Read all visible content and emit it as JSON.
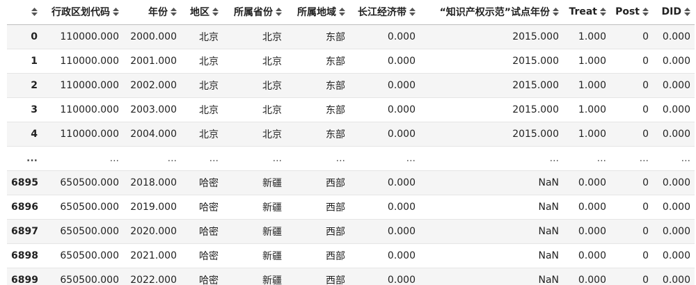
{
  "table": {
    "columns": [
      "",
      "行政区划代码",
      "年份",
      "地区",
      "所属省份",
      "所属地域",
      "长江经济带",
      "“知识产权示范”试点年份",
      "Treat",
      "Post",
      "DID"
    ],
    "rows": [
      [
        "0",
        "110000.000",
        "2000.000",
        "北京",
        "北京",
        "东部",
        "0.000",
        "2015.000",
        "1.000",
        "0",
        "0.000"
      ],
      [
        "1",
        "110000.000",
        "2001.000",
        "北京",
        "北京",
        "东部",
        "0.000",
        "2015.000",
        "1.000",
        "0",
        "0.000"
      ],
      [
        "2",
        "110000.000",
        "2002.000",
        "北京",
        "北京",
        "东部",
        "0.000",
        "2015.000",
        "1.000",
        "0",
        "0.000"
      ],
      [
        "3",
        "110000.000",
        "2003.000",
        "北京",
        "北京",
        "东部",
        "0.000",
        "2015.000",
        "1.000",
        "0",
        "0.000"
      ],
      [
        "4",
        "110000.000",
        "2004.000",
        "北京",
        "北京",
        "东部",
        "0.000",
        "2015.000",
        "1.000",
        "0",
        "0.000"
      ],
      [
        "...",
        "...",
        "...",
        "...",
        "...",
        "...",
        "...",
        "...",
        "...",
        "...",
        "..."
      ],
      [
        "6895",
        "650500.000",
        "2018.000",
        "哈密",
        "新疆",
        "西部",
        "0.000",
        "NaN",
        "0.000",
        "0",
        "0.000"
      ],
      [
        "6896",
        "650500.000",
        "2019.000",
        "哈密",
        "新疆",
        "西部",
        "0.000",
        "NaN",
        "0.000",
        "0",
        "0.000"
      ],
      [
        "6897",
        "650500.000",
        "2020.000",
        "哈密",
        "新疆",
        "西部",
        "0.000",
        "NaN",
        "0.000",
        "0",
        "0.000"
      ],
      [
        "6898",
        "650500.000",
        "2021.000",
        "哈密",
        "新疆",
        "西部",
        "0.000",
        "NaN",
        "0.000",
        "0",
        "0.000"
      ],
      [
        "6899",
        "650500.000",
        "2022.000",
        "哈密",
        "新疆",
        "西部",
        "0.000",
        "NaN",
        "0.000",
        "0",
        "0.000"
      ]
    ]
  },
  "icons": {
    "sort": "sort-icon"
  },
  "colors": {
    "stripe": "#f5f5f5",
    "text": "#222222",
    "border": "#e5e5e5"
  }
}
